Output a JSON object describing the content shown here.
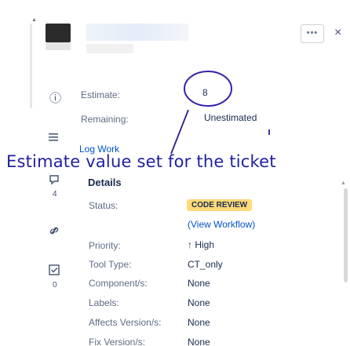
{
  "header": {
    "more_label": "•••",
    "close_label": "×"
  },
  "sidebar": {
    "info_icon": "ⓘ",
    "comment_badge": "4",
    "approvals_badge": "0",
    "scroll_up": "▲"
  },
  "estimate": {
    "label": "Estimate:",
    "value": "8"
  },
  "remaining": {
    "label": "Remaining:",
    "value": "Unestimated"
  },
  "log_work": {
    "label": "Log Work"
  },
  "annotation": {
    "text": "Estimate value set for the ticket",
    "color": "#1f1fa0"
  },
  "details": {
    "title": "Details",
    "status_label": "Status:",
    "status_value": "CODE REVIEW",
    "status_color": "#ffd978",
    "view_workflow": "(View Workflow)",
    "fields": [
      {
        "label": "Priority:",
        "value": "↑ High"
      },
      {
        "label": "Tool Type:",
        "value": "CT_only"
      },
      {
        "label": "Component/s:",
        "value": "None"
      },
      {
        "label": "Labels:",
        "value": "None"
      },
      {
        "label": "Affects Version/s:",
        "value": "None"
      },
      {
        "label": "Fix Version/s:",
        "value": "None"
      }
    ]
  }
}
